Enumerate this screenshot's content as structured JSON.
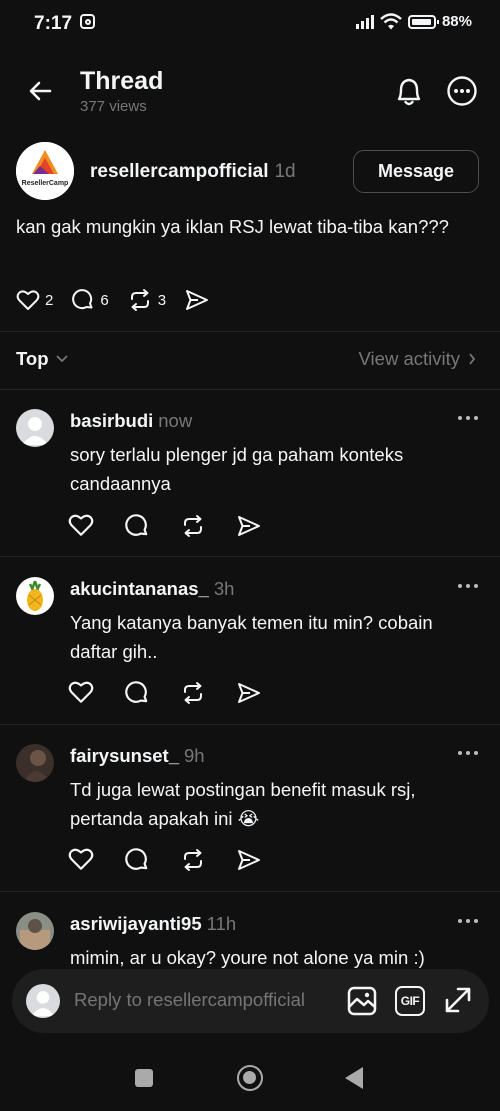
{
  "status_bar": {
    "time": "7:17",
    "battery": "88%"
  },
  "header": {
    "title": "Thread",
    "views": "377 views"
  },
  "post": {
    "author": "resellercampofficial",
    "time": "1d",
    "message_label": "Message",
    "text": "kan gak mungkin ya iklan RSJ lewat tiba-tiba kan???",
    "likes": "2",
    "replies": "6",
    "reposts": "3",
    "logo_text": "ResellerCamp"
  },
  "sort": {
    "label": "Top",
    "activity_label": "View activity"
  },
  "replies": [
    {
      "username": "basirbudi",
      "time": "now",
      "text": "sory terlalu plenger jd ga paham konteks candaannya"
    },
    {
      "username": "akucintananas_",
      "time": "3h",
      "text": "Yang katanya banyak temen itu min? cobain daftar gih.."
    },
    {
      "username": "fairysunset_",
      "time": "9h",
      "text": "Td juga lewat postingan benefit masuk rsj, pertanda apakah ini 😭"
    },
    {
      "username": "asriwijayanti95",
      "time": "11h",
      "text": "mimin, ar u okay? youre not alone ya min :)"
    }
  ],
  "composer": {
    "placeholder": "Reply to resellercampofficial",
    "gif_label": "GIF"
  },
  "colors": {
    "background": "#101010",
    "text": "#f3f5f7",
    "muted": "#777777",
    "divider": "#262626"
  }
}
